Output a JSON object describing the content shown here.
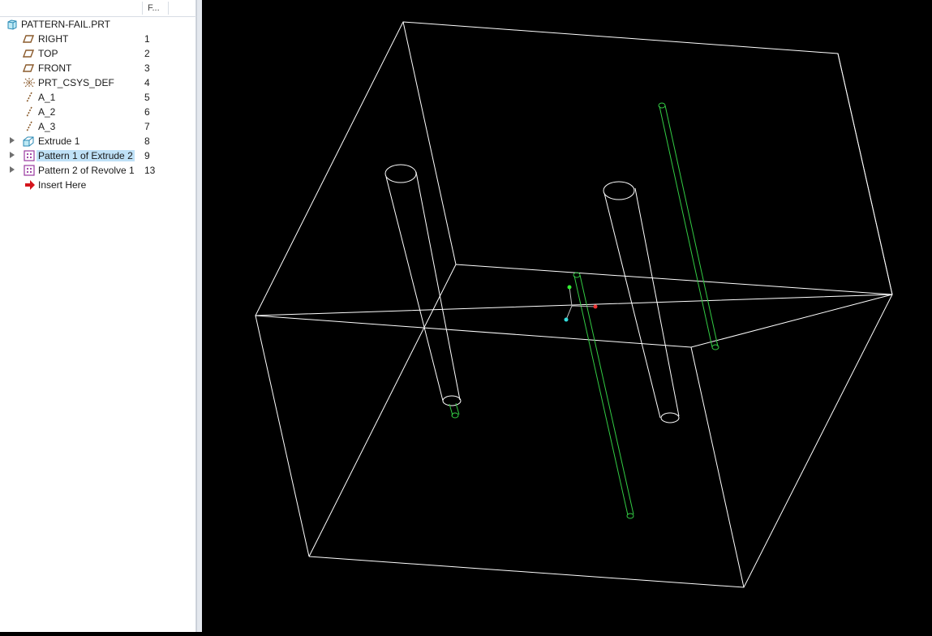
{
  "model_tree": {
    "column_header": "F...",
    "root": {
      "label": "PATTERN-FAIL.PRT",
      "icon": "part-icon"
    },
    "items": [
      {
        "label": "RIGHT",
        "num": "1",
        "icon": "datum-plane-icon"
      },
      {
        "label": "TOP",
        "num": "2",
        "icon": "datum-plane-icon"
      },
      {
        "label": "FRONT",
        "num": "3",
        "icon": "datum-plane-icon"
      },
      {
        "label": "PRT_CSYS_DEF",
        "num": "4",
        "icon": "coordinate-system-icon"
      },
      {
        "label": "A_1",
        "num": "5",
        "icon": "datum-axis-icon"
      },
      {
        "label": "A_2",
        "num": "6",
        "icon": "datum-axis-icon"
      },
      {
        "label": "A_3",
        "num": "7",
        "icon": "datum-axis-icon"
      },
      {
        "label": "Extrude 1",
        "num": "8",
        "icon": "extrude-icon"
      },
      {
        "label": "Pattern 1 of Extrude 2",
        "num": "9",
        "icon": "pattern-icon"
      },
      {
        "label": "Pattern 2 of Revolve 1",
        "num": "13",
        "icon": "pattern-icon"
      },
      {
        "label": "Insert Here",
        "num": "",
        "icon": "insert-arrow-icon"
      }
    ]
  },
  "colors": {
    "viewport_background": "#000000",
    "edge_color": "#ffffff",
    "highlight_color": "#33cc44",
    "selection_background": "#bfe1f7"
  }
}
